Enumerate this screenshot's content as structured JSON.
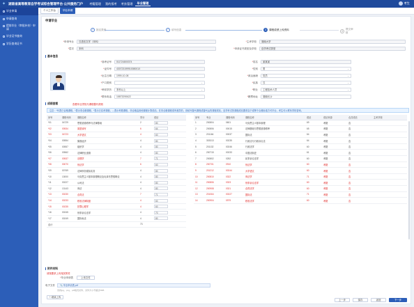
{
  "topbar": {
    "logo": "✦",
    "title": "湖南省高等教育自学考试综合管理平台·公共服务门户",
    "nav": [
      "考籍管理",
      "我的报考",
      "考务管理",
      "毕业管理"
    ],
    "user": "考生"
  },
  "sidebar": {
    "items": [
      {
        "label": "毕业申请"
      },
      {
        "label": "申请查询"
      },
      {
        "label": "提前毕业（审批补充）申请"
      },
      {
        "label": "毕业证书查询"
      },
      {
        "label": "学历查询证书"
      }
    ]
  },
  "tabs": [
    "个人工作台",
    "毕业申请"
  ],
  "page": {
    "title": "申请毕业"
  },
  "steps": [
    {
      "num": "✓",
      "label": "报名类别"
    },
    {
      "num": "✓",
      "label": "填写信息"
    },
    {
      "num": "3",
      "label": "课程成绩上传资料"
    },
    {
      "num": "4",
      "label": "提交审核"
    }
  ],
  "top_fields": {
    "l1": "申请专业",
    "v1": "汉语言文学（本科）",
    "l2": "主考学校",
    "v2": "湖南大学",
    "l3": "层次",
    "v3": "本科",
    "l4": "申请证书类型及学校",
    "v4": "自学考试类型"
  },
  "basic": {
    "section": "基本信息",
    "fields": [
      {
        "l": "准考证号",
        "v": "011724800374"
      },
      {
        "l": "姓名",
        "v": "某某某"
      },
      {
        "l": "证件号",
        "v": "43072319991008001X"
      },
      {
        "l": "性别",
        "v": "男"
      },
      {
        "l": "出生日期",
        "v": "1999-10-08"
      },
      {
        "l": "政治面貌",
        "v": "党员"
      },
      {
        "l": "户口类别",
        "v": ""
      },
      {
        "l": "民族",
        "v": "汉"
      },
      {
        "l": "考前学历",
        "v": "本科以上"
      },
      {
        "l": "职业",
        "v": "工程技术人员"
      },
      {
        "l": "联系电话",
        "v": "15873290622"
      },
      {
        "l": "籍贯地址",
        "v": "湖南长沙"
      }
    ]
  },
  "score_section": {
    "title": "成绩查看",
    "note": "查看毕业须知与课程替代规则",
    "notice": "注意：*代表已合格课程，*表示非合格课程，*表示已实考课程，---表示考籍课程，非合格由其他课程计算成绩。在非合格课程或有差异的，则填写替代课程或替代后的课程成绩。自学考试的课程成绩要求高于或等于合格标准方可毕业，考生可以联系学校咨询。"
  },
  "left_table": {
    "headers": [
      "序号",
      "课程代码",
      "课程名称",
      "学分",
      "成绩"
    ],
    "rows": [
      {
        "n": "*01",
        "code": "04729",
        "name": "思想道德修养与法律基础",
        "credit": "2",
        "score": "80",
        "red": false
      },
      {
        "n": "*02",
        "code": "00534",
        "name": "英语读写",
        "credit": "6",
        "score": "64",
        "red": true
      },
      {
        "n": "*03",
        "code": "04723",
        "name": "大学语文",
        "credit": "4",
        "score": "60",
        "red": true
      },
      {
        "n": "*04",
        "code": "00554",
        "name": "微观经济",
        "credit": "4",
        "score": "80",
        "red": false
      },
      {
        "n": "*05",
        "code": "00557",
        "name": "组织学",
        "credit": "4",
        "score": "80",
        "red": false
      },
      {
        "n": "*06",
        "code": "00562",
        "name": "法律职业道德",
        "credit": "4",
        "score": "80",
        "red": false
      },
      {
        "n": "*07",
        "code": "00537",
        "name": "法理学",
        "credit": "7",
        "score": "71",
        "red": true
      },
      {
        "n": "*08",
        "code": "00070",
        "name": "刑法学",
        "credit": "6",
        "score": "60",
        "red": true
      },
      {
        "n": "*09",
        "code": "00769",
        "name": "法律事务模拟实务",
        "credit": "4",
        "score": "80",
        "red": false
      },
      {
        "n": "*10",
        "code": "13000",
        "name": "马克思主义基本原理概论及毛泽东思想概论",
        "credit": "4",
        "score": "80",
        "red": false
      },
      {
        "n": "*11",
        "code": "00227",
        "name": "公司法",
        "credit": "4",
        "score": "80",
        "red": false
      },
      {
        "n": "*12",
        "code": "13143",
        "name": "商法",
        "credit": "4",
        "score": "80",
        "red": false
      },
      {
        "n": "*13",
        "code": "00230",
        "name": "合同法",
        "credit": "7",
        "score": "71",
        "red": true
      },
      {
        "n": "*14",
        "code": "00233",
        "name": "税收法律制度",
        "credit": "4",
        "score": "60",
        "red": true
      },
      {
        "n": "*15",
        "code": "00235",
        "name": "犯罪心理学",
        "credit": "4",
        "score": "60",
        "red": true
      },
      {
        "n": "*16",
        "code": "00245",
        "name": "刑事诉讼法学",
        "credit": "4",
        "score": "70",
        "red": false
      },
      {
        "n": "*17",
        "code": "00249",
        "name": "国际私法",
        "credit": "4",
        "score": "80",
        "red": false
      }
    ],
    "total_label": "合计",
    "total_value": "73"
  },
  "right_table": {
    "headers": [
      "序号",
      "专业",
      "课程代码",
      "课程名称",
      "成绩",
      "成绩来源",
      "合并成绩",
      "主考学校"
    ],
    "rows": [
      {
        "n": "1",
        "major": "200804",
        "code": "0601",
        "name": "马克思主义基本原理",
        "score": "69",
        "src": "考籍",
        "merge": "否",
        "school": "",
        "red": false
      },
      {
        "n": "2",
        "major": "200806",
        "code": "00015",
        "name": "法律基础与思想道德修养",
        "score": "65",
        "src": "考籍",
        "merge": "否",
        "school": "",
        "red": false
      },
      {
        "n": "3",
        "major": "201164",
        "code": "00037",
        "name": "国际法",
        "score": "64",
        "src": "考籍",
        "merge": "否",
        "school": "",
        "red": false
      },
      {
        "n": "4",
        "major": "303313",
        "code": "00235",
        "name": "行政法与行政诉讼法",
        "score": "64",
        "src": "考籍",
        "merge": "否",
        "school": "",
        "red": false
      },
      {
        "n": "5",
        "major": "201132",
        "code": "00246",
        "name": "行政法学",
        "score": "60",
        "src": "考籍",
        "merge": "否",
        "school": "",
        "red": false
      },
      {
        "n": "6",
        "major": "200715",
        "code": "00233",
        "name": "中国法制史",
        "score": "61",
        "src": "考籍",
        "merge": "否",
        "school": "",
        "red": false
      },
      {
        "n": "7",
        "major": "200802",
        "code": "0252",
        "name": "民事诉讼法学",
        "score": "60",
        "src": "考籍",
        "merge": "否",
        "school": "",
        "red": false
      },
      {
        "n": "8",
        "major": "200701",
        "code": "0910",
        "name": "刑法学",
        "score": "60",
        "src": "考籍",
        "merge": "否",
        "school": "",
        "red": true
      },
      {
        "n": "9",
        "major": "201212",
        "code": "00244",
        "name": "大学语文",
        "score": "60",
        "src": "考籍",
        "merge": "否",
        "school": "",
        "red": true
      },
      {
        "n": "10",
        "major": "200810",
        "code": "0322",
        "name": "商法学",
        "score": "71",
        "src": "考籍",
        "merge": "否",
        "school": "",
        "red": true
      },
      {
        "n": "11",
        "major": "200806",
        "code": "0323",
        "name": "刑事诉讼法学",
        "score": "60",
        "src": "考籍",
        "merge": "否",
        "school": "",
        "red": true
      },
      {
        "n": "12",
        "major": "200908",
        "code": "0321",
        "name": "合同法学",
        "score": "60",
        "src": "考籍",
        "merge": "否",
        "school": "",
        "red": true
      },
      {
        "n": "13",
        "major": "201064",
        "code": "00227",
        "name": "国际法",
        "score": "71",
        "src": "考籍",
        "merge": "否",
        "school": "",
        "red": true
      },
      {
        "n": "14",
        "major": "200904",
        "code": "0979",
        "name": "税收法学",
        "score": "60",
        "src": "考籍",
        "merge": "否",
        "school": "",
        "red": true
      }
    ]
  },
  "attachments": {
    "title": "附件材料",
    "note": "请按要求上传相关附件",
    "label": "毕业申请表",
    "sub_label": "电子文件",
    "upload_hint": "上传文件",
    "file": "📎 毕业申请表.pdf",
    "hint": "支持jpg、png、pdf格式文件，文件大小不超过5MB",
    "upload_button": "+ 继续上传"
  },
  "footer_buttons": [
    "上一步",
    "保存",
    "返回",
    "下一步"
  ]
}
